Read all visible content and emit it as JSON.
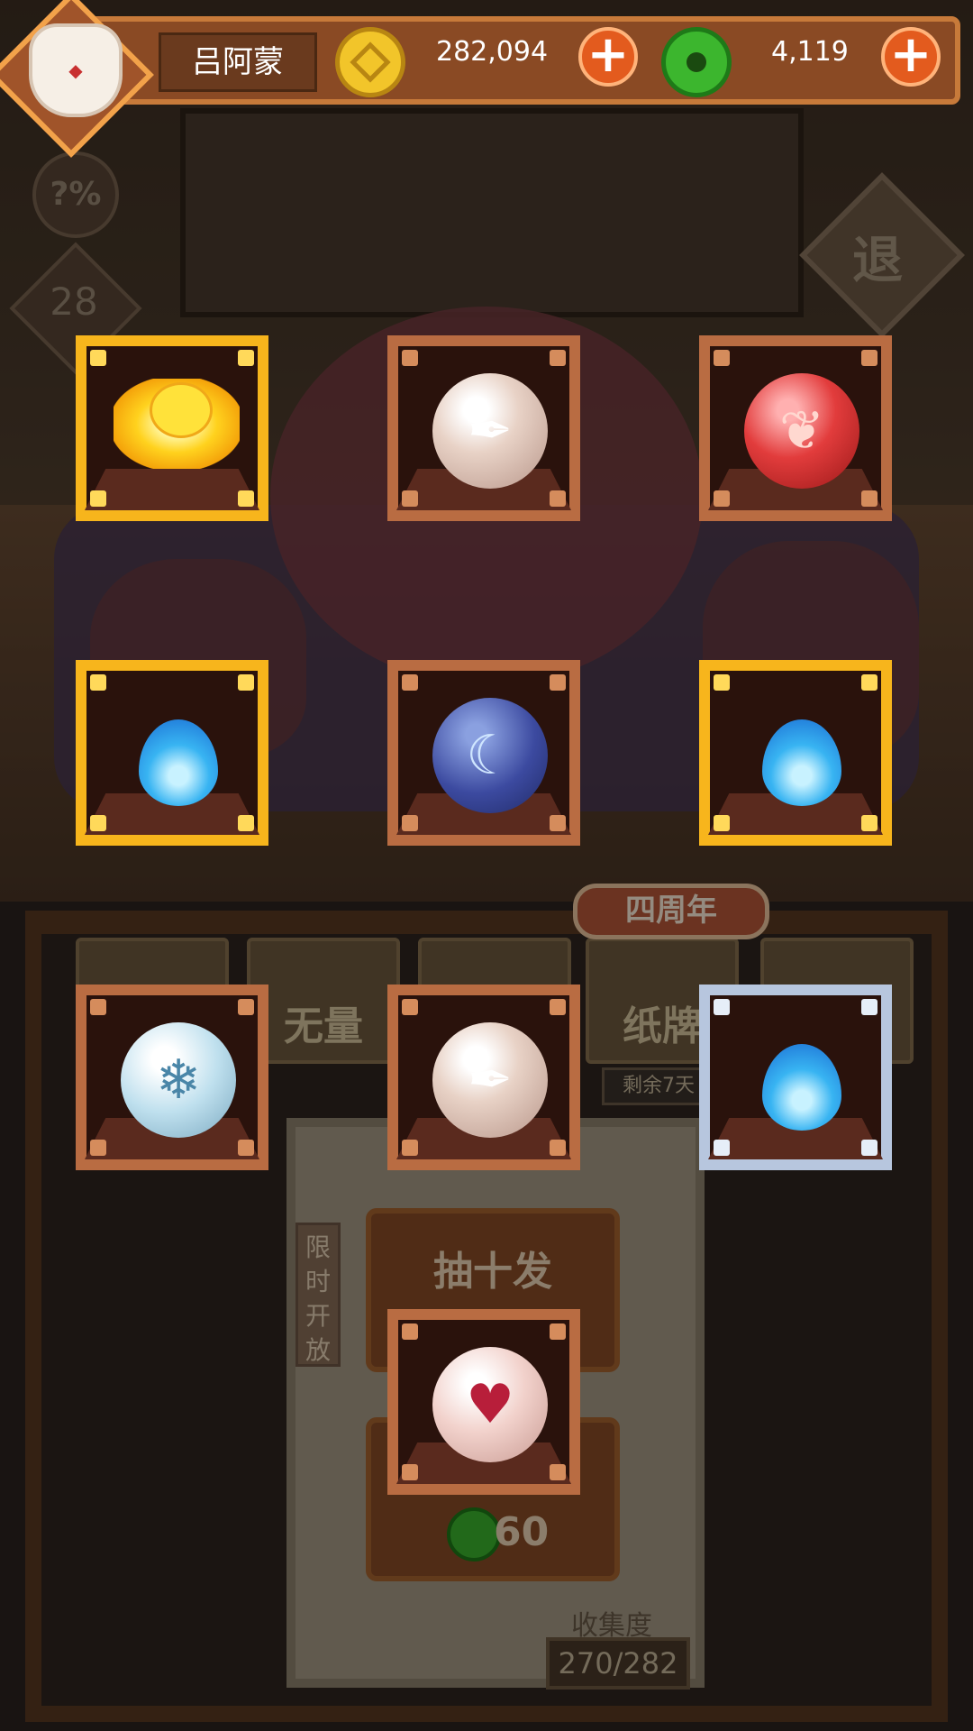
{
  "player": {
    "name": "吕阿蒙"
  },
  "currency": {
    "gold": "282,094",
    "jade": "4,119"
  },
  "side": {
    "probability_label": "?%",
    "level_badge": "28"
  },
  "exit_label": "退",
  "lower": {
    "tabs": [
      "",
      "无量",
      "",
      "纸牌",
      ""
    ],
    "anniversary_tag": "四周年",
    "remaining_label": "剩余7天",
    "limited_label": "限时开放",
    "draw_ten_label": "抽十发",
    "draw_one_cost": "60",
    "collection_label": "收集度",
    "collection_value": "270/282"
  },
  "slots": [
    {
      "item": "golden-lotus-chick",
      "frame": "gold"
    },
    {
      "item": "feather-orb",
      "frame": "wood"
    },
    {
      "item": "red-wing-orb",
      "frame": "wood"
    },
    {
      "item": "blue-flame",
      "frame": "gold"
    },
    {
      "item": "moon-orb",
      "frame": "wood"
    },
    {
      "item": "blue-flame",
      "frame": "gold"
    },
    {
      "item": "snowflake-orb",
      "frame": "wood"
    },
    {
      "item": "feather-orb",
      "frame": "wood"
    },
    {
      "item": "blue-flame",
      "frame": "silver"
    },
    {
      "item": "crowned-heart-orb",
      "frame": "wood"
    }
  ],
  "colors": {
    "gold_frame": "#f7b51c",
    "wood_frame": "#b96c42",
    "silver_frame": "#b7c6de",
    "plus_button": "#e35b1e"
  }
}
